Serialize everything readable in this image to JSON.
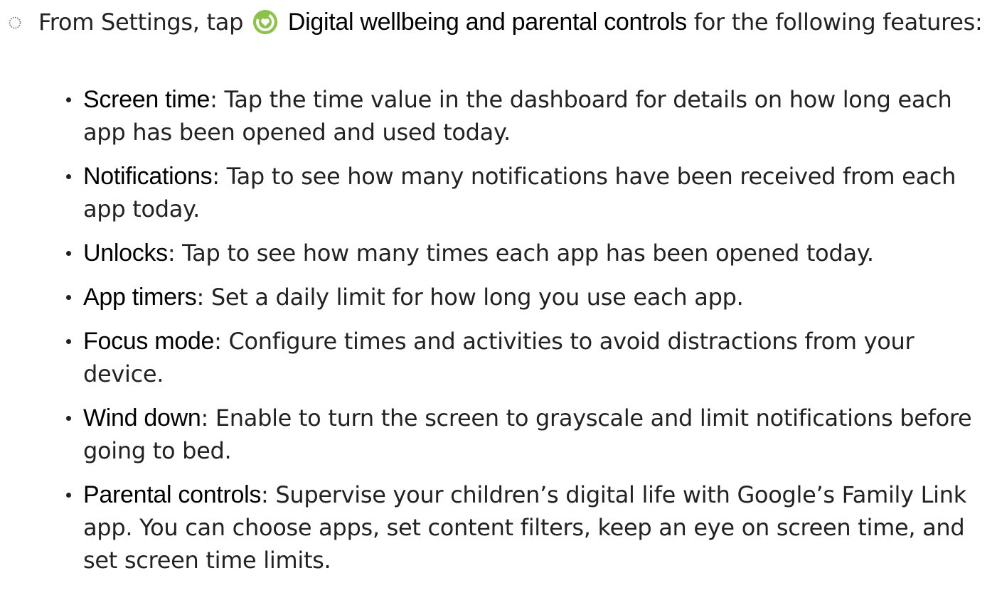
{
  "step": {
    "prefix": "From Settings, tap",
    "app_name": "Digital wellbeing and parental controls",
    "suffix": "for the following features:",
    "icon": "digital-wellbeing-icon",
    "icon_color": "#8bc34a"
  },
  "features": [
    {
      "title": "Screen time",
      "sep": ":",
      "text": " Tap the time value in the dashboard for details on how long each app has been opened and used today."
    },
    {
      "title": "Notifications",
      "sep": ":",
      "text": " Tap to see how many notifications have been received from each app today."
    },
    {
      "title": "Unlocks",
      "sep": ":",
      "text": " Tap to see how many times each app has been opened today."
    },
    {
      "title": "App timers",
      "sep": ":",
      "text": " Set a daily limit for how long you use each app."
    },
    {
      "title": "Focus mode",
      "sep": ":",
      "text": " Configure times and activities to avoid distractions from your device."
    },
    {
      "title": "Wind down",
      "sep": ":",
      "text": " Enable to turn the screen to grayscale and limit notifications before going to bed."
    },
    {
      "title": "Parental controls",
      "sep": ":",
      "text": " Supervise your children’s digital life with Google’s Family Link app. You can choose apps, set content filters, keep an eye on screen time, and set screen time limits."
    }
  ]
}
